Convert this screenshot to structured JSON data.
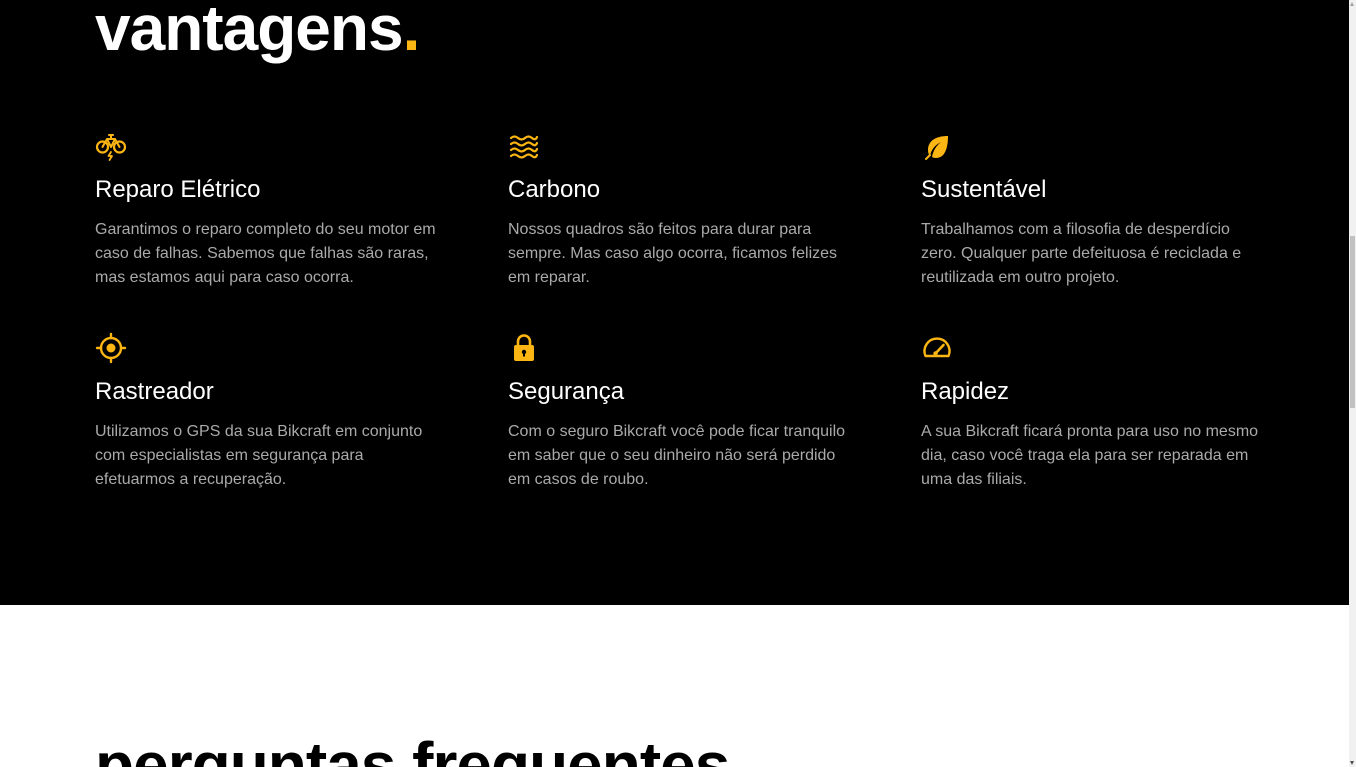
{
  "colors": {
    "accent": "#fbb613",
    "dark_bg": "#000000",
    "text_light": "#ffffff",
    "text_muted": "#aaaaaa"
  },
  "vantagens": {
    "title": "vantagens",
    "title_dot": ".",
    "items": [
      {
        "icon": "electric-bike-icon",
        "title": "Reparo Elétrico",
        "text": "Garantimos o reparo completo do seu motor em caso de falhas. Sabemos que falhas são raras, mas estamos aqui para caso ocorra."
      },
      {
        "icon": "waves-icon",
        "title": "Carbono",
        "text": "Nossos quadros são feitos para durar para sempre. Mas caso algo ocorra, ficamos felizes em reparar."
      },
      {
        "icon": "leaf-icon",
        "title": "Sustentável",
        "text": "Trabalhamos com a filosofia de desperdício zero. Qualquer parte defeituosa é reciclada e reutilizada em outro projeto."
      },
      {
        "icon": "gps-target-icon",
        "title": "Rastreador",
        "text": "Utilizamos o GPS da sua Bikcraft em conjunto com especialistas em segurança para efetuarmos a recuperação."
      },
      {
        "icon": "padlock-icon",
        "title": "Segurança",
        "text": "Com o seguro Bikcraft você pode ficar tranquilo em saber que o seu dinheiro não será perdido em casos de roubo."
      },
      {
        "icon": "speedometer-icon",
        "title": "Rapidez",
        "text": "A sua Bikcraft ficará pronta para uso no mesmo dia, caso você traga ela para ser reparada em uma das filiais."
      }
    ]
  },
  "perguntas": {
    "title": "perguntas frequentes"
  }
}
